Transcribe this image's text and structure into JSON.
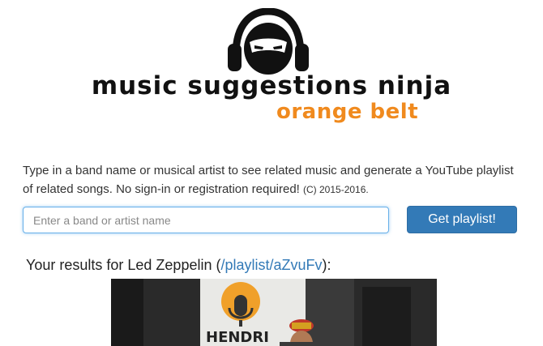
{
  "logo": {
    "icon": "ninja-headphones-icon",
    "title": "music suggestions ninja",
    "subtitle": "orange belt"
  },
  "intro": {
    "text": "Type in a band name or musical artist to see related music and generate a YouTube playlist of related songs. No sign-in or registration required!",
    "copyright": "(C) 2015-2016."
  },
  "search": {
    "placeholder": "Enter a band or artist name",
    "value": "",
    "button_label": "Get playlist!"
  },
  "results": {
    "prefix": "Your results for Led Zeppelin (",
    "link_text": "/playlist/aZvuFv",
    "suffix": "):"
  },
  "video": {
    "thumbnail_sign_text": "HENDRI"
  },
  "colors": {
    "accent": "#337ab7",
    "brand_orange": "#f08a1e"
  }
}
